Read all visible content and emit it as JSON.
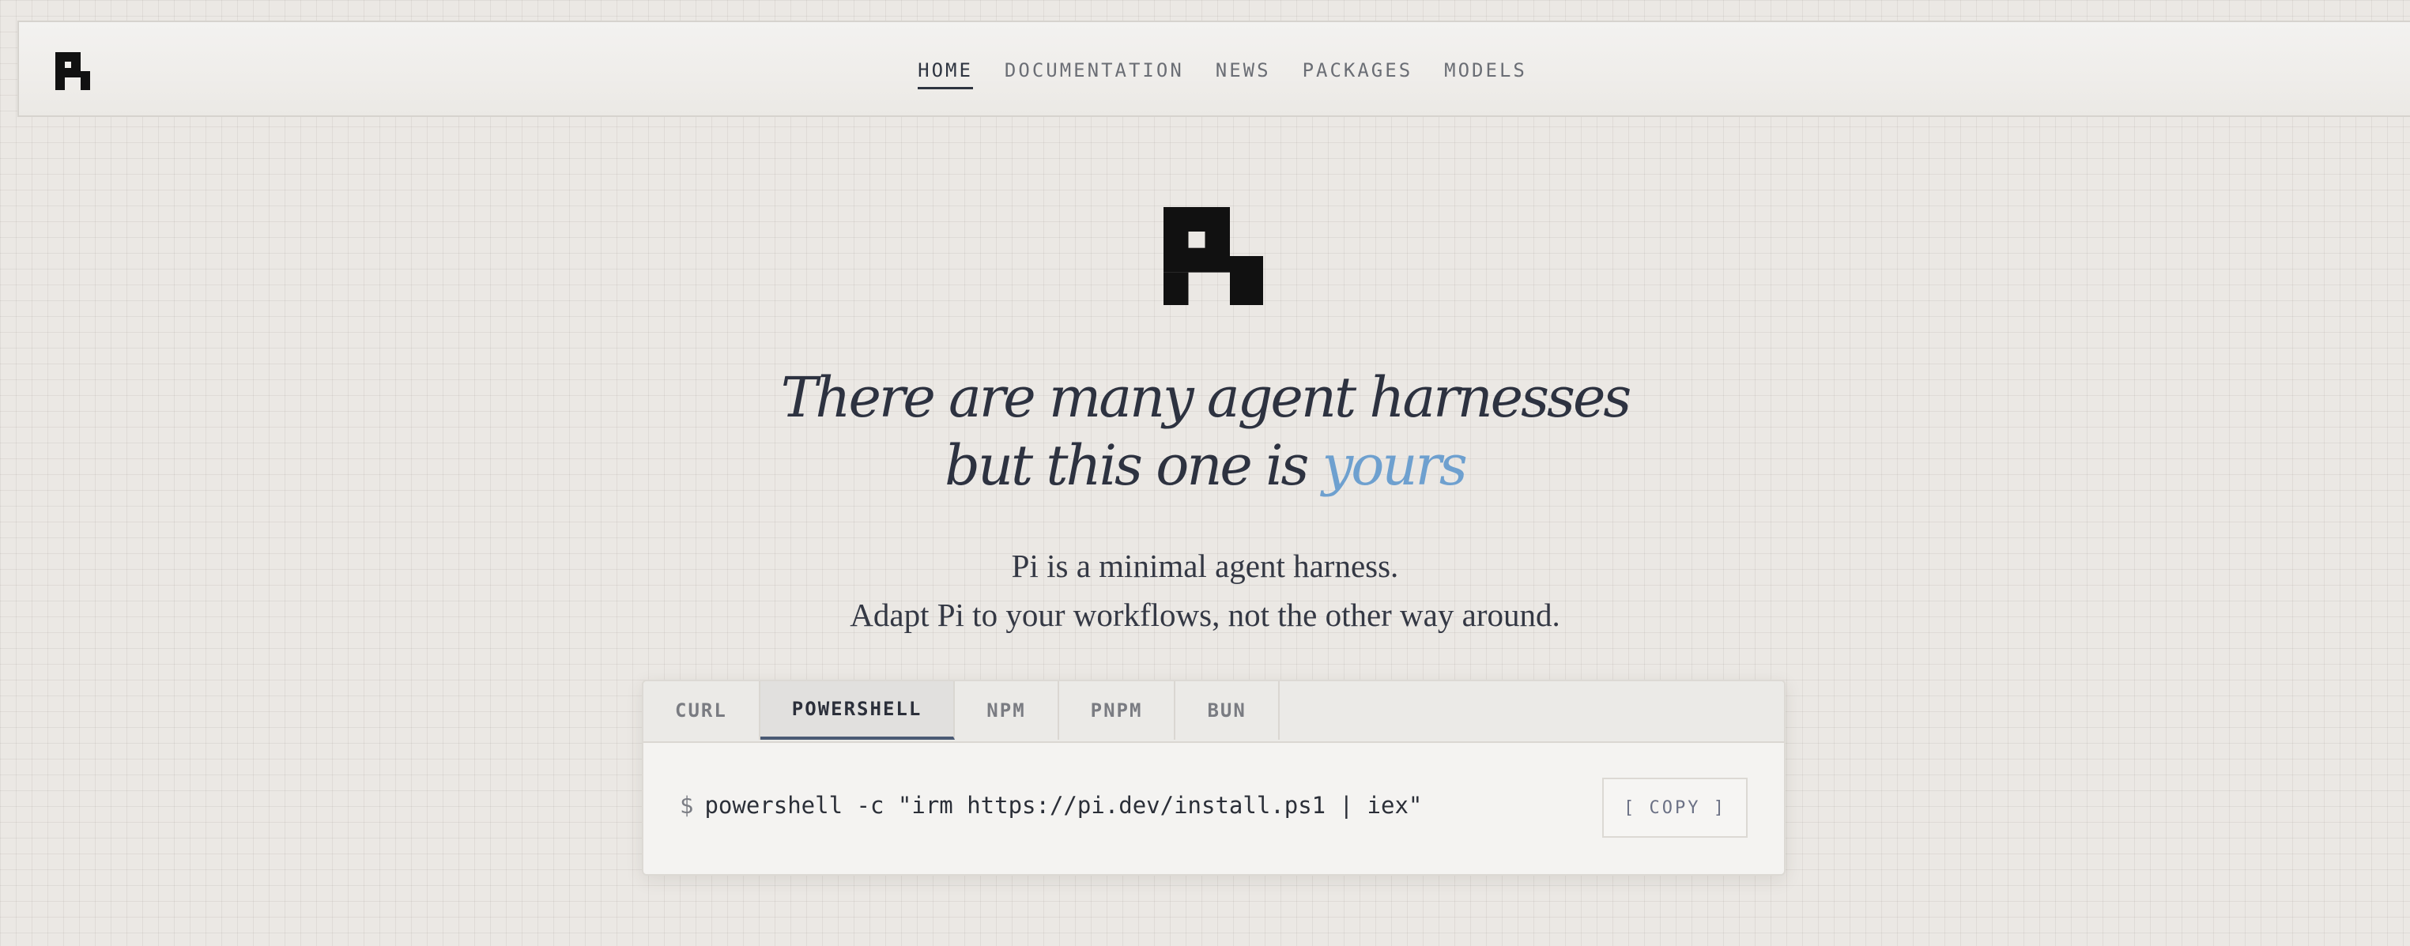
{
  "nav": {
    "logo_icon": "pi-logo-icon",
    "links": [
      {
        "label": "HOME",
        "active": true
      },
      {
        "label": "DOCUMENTATION",
        "active": false
      },
      {
        "label": "NEWS",
        "active": false
      },
      {
        "label": "PACKAGES",
        "active": false
      },
      {
        "label": "MODELS",
        "active": false
      }
    ]
  },
  "hero": {
    "logo_icon": "pi-logo-icon",
    "headline_line1": "There are many agent harnesses",
    "headline_line2_prefix": "but this one is",
    "headline_line2_accent": "yours",
    "subtitle_line1": "Pi is a minimal agent harness.",
    "subtitle_line2": "Adapt Pi to your workflows, not the other way around."
  },
  "install": {
    "tabs": [
      {
        "label": "CURL",
        "active": false
      },
      {
        "label": "POWERSHELL",
        "active": true
      },
      {
        "label": "NPM",
        "active": false
      },
      {
        "label": "PNPM",
        "active": false
      },
      {
        "label": "BUN",
        "active": false
      }
    ],
    "prompt": "$",
    "command": "powershell -c \"irm https://pi.dev/install.ps1 | iex\"",
    "copy_label": "[ COPY ]"
  },
  "colors": {
    "accent": "#6ea0cf",
    "text_dark": "#2d3240",
    "background": "#ebe8e4",
    "active_tab_underline": "#4a5a74"
  }
}
